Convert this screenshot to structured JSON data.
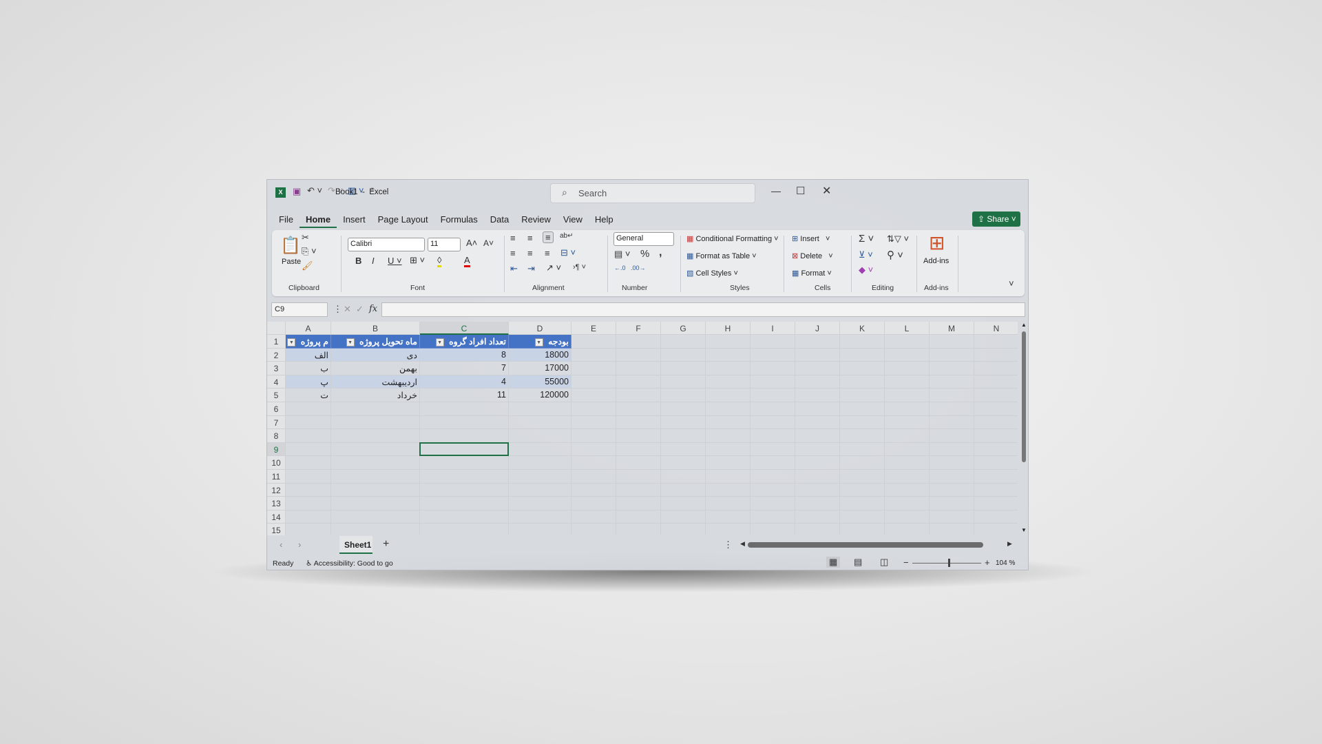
{
  "window": {
    "title": "Book1  -  Excel",
    "search_placeholder": "Search",
    "share_label": "Share"
  },
  "tabs": [
    "File",
    "Home",
    "Insert",
    "Page Layout",
    "Formulas",
    "Data",
    "Review",
    "View",
    "Help"
  ],
  "active_tab": "Home",
  "ribbon": {
    "clipboard": {
      "label": "Clipboard",
      "paste": "Paste"
    },
    "font": {
      "label": "Font",
      "name": "Calibri",
      "size": "11"
    },
    "alignment": {
      "label": "Alignment"
    },
    "number": {
      "label": "Number",
      "format": "General"
    },
    "styles": {
      "label": "Styles",
      "conditional": "Conditional Formatting",
      "format_table": "Format as Table",
      "cell_styles": "Cell Styles"
    },
    "cells": {
      "label": "Cells",
      "insert": "Insert",
      "delete": "Delete",
      "format": "Format"
    },
    "editing": {
      "label": "Editing"
    },
    "addins": {
      "label": "Add-ins",
      "button": "Add-ins"
    }
  },
  "formula_bar": {
    "name_box": "C9",
    "fx": "fx",
    "value": ""
  },
  "columns": [
    "A",
    "B",
    "C",
    "D",
    "E",
    "F",
    "G",
    "H",
    "I",
    "J",
    "K",
    "L",
    "M",
    "N"
  ],
  "rows": [
    "1",
    "2",
    "3",
    "4",
    "5",
    "6",
    "7",
    "8",
    "9",
    "10",
    "11",
    "12",
    "13",
    "14",
    "15"
  ],
  "table": {
    "headers": [
      "م پروژه",
      "ماه تحویل پروژه",
      "تعداد افراد گروه",
      "بودجه"
    ],
    "rows": [
      [
        "الف",
        "دی",
        "8",
        "18000"
      ],
      [
        "ب",
        "بهمن",
        "7",
        "17000"
      ],
      [
        "پ",
        "اردیبهشت",
        "4",
        "55000"
      ],
      [
        "ت",
        "خرداد",
        "11",
        "120000"
      ]
    ]
  },
  "selected_cell": "C9",
  "sheets": [
    "Sheet1"
  ],
  "status": {
    "ready": "Ready",
    "accessibility": "Accessibility: Good to go",
    "zoom": "104 %"
  },
  "colors": {
    "accent": "#1e7145",
    "table_header": "#4472c4",
    "table_band": "#c9d3e6"
  }
}
